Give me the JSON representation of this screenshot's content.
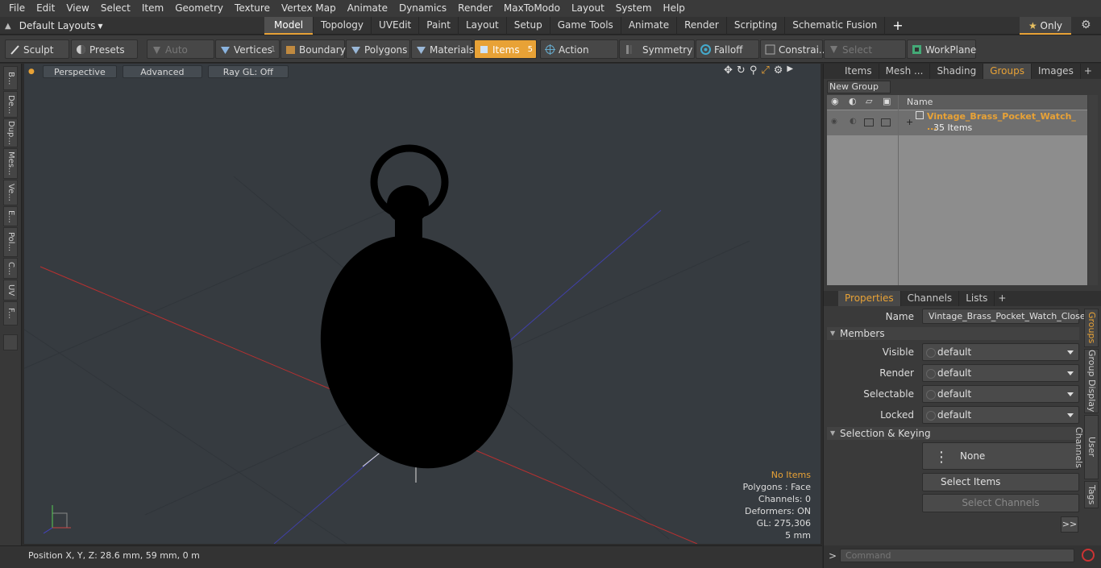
{
  "menu": [
    "File",
    "Edit",
    "View",
    "Select",
    "Item",
    "Geometry",
    "Texture",
    "Vertex Map",
    "Animate",
    "Dynamics",
    "Render",
    "MaxToModo",
    "Layout",
    "System",
    "Help"
  ],
  "layout_selector": "Default Layouts",
  "mode_tabs": [
    "Model",
    "Topology",
    "UVEdit",
    "Paint",
    "Layout",
    "Setup",
    "Game Tools",
    "Animate",
    "Render",
    "Scripting",
    "Schematic Fusion"
  ],
  "only_label": "Only",
  "toolbar": {
    "sculpt": "Sculpt",
    "presets": "Presets",
    "auto_select": "Auto Select",
    "vertices": "Vertices",
    "vertices_count": "1",
    "boundary": "Boundary",
    "polygons": "Polygons",
    "materials": "Materials",
    "items": "Items",
    "items_count": "5",
    "action_center": "Action Center",
    "symmetry": "Symmetry",
    "falloff": "Falloff",
    "constraints": "Constrai...",
    "select_through": "Select Through",
    "workplane": "WorkPlane"
  },
  "left_tabs": [
    "B...",
    "De...",
    "Dup...",
    "Mes...",
    "Ve...",
    "E...",
    "Pol...",
    "C...",
    "UV",
    "F..."
  ],
  "viewport": {
    "view": "Perspective",
    "shading": "Advanced",
    "raygl": "Ray GL: Off",
    "info": {
      "items": "No Items",
      "polygons": "Polygons : Face",
      "channels": "Channels: 0",
      "deformers": "Deformers: ON",
      "gl": "GL: 275,306",
      "scale": "5 mm"
    }
  },
  "status_bar": "Position X, Y, Z:   28.6 mm, 59 mm, 0 m",
  "top_panel": {
    "tabs": [
      "Items",
      "Mesh ...",
      "Shading",
      "Groups",
      "Images"
    ],
    "new_group": "New Group",
    "column_name": "Name",
    "group_name": "Vintage_Brass_Pocket_Watch_ ...",
    "group_count": "35 Items"
  },
  "properties": {
    "tabs": [
      "Properties",
      "Channels",
      "Lists"
    ],
    "name_label": "Name",
    "name_value": "Vintage_Brass_Pocket_Watch_Closed",
    "members_section": "Members",
    "visible_label": "Visible",
    "visible_value": "default",
    "render_label": "Render",
    "render_value": "default",
    "selectable_label": "Selectable",
    "selectable_value": "default",
    "locked_label": "Locked",
    "locked_value": "default",
    "sel_section": "Selection & Keying",
    "none_label": "None",
    "select_items": "Select Items",
    "select_channels": "Select Channels",
    "more": ">>",
    "side_tabs": [
      "Groups",
      "Group Display",
      "User Channels",
      "Tags"
    ]
  },
  "command_placeholder": "Command",
  "accent_color": "#e8a236"
}
